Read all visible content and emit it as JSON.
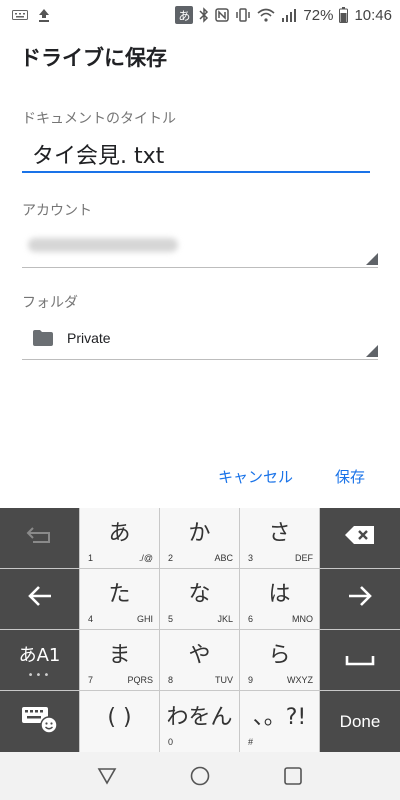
{
  "status_bar": {
    "ime_indicator": "あ",
    "battery_percent": "72%",
    "time": "10:46",
    "left_icons": [
      "keyboard-icon",
      "upload-icon"
    ],
    "right_icons": [
      "bluetooth-icon",
      "nfc-icon",
      "vibrate-icon",
      "wifi-icon",
      "signal-icon",
      "battery-icon"
    ]
  },
  "dialog": {
    "title": "ドライブに保存",
    "doc_title_label": "ドキュメントのタイトル",
    "doc_title_value": "タイ会見. txt",
    "account_label": "アカウント",
    "folder_label": "フォルダ",
    "folder_name": "Private",
    "cancel_label": "キャンセル",
    "save_label": "保存",
    "accent_color": "#1a73e8"
  },
  "keyboard": {
    "row1": [
      {
        "icon": "undo-icon"
      },
      {
        "main": "あ",
        "num": "1",
        "sub": "./@"
      },
      {
        "main": "か",
        "num": "2",
        "sub": "ABC"
      },
      {
        "main": "さ",
        "num": "3",
        "sub": "DEF"
      },
      {
        "icon": "backspace-icon"
      }
    ],
    "row2": [
      {
        "icon": "arrow-left-icon"
      },
      {
        "main": "た",
        "num": "4",
        "sub": "GHI"
      },
      {
        "main": "な",
        "num": "5",
        "sub": "JKL"
      },
      {
        "main": "は",
        "num": "6",
        "sub": "MNO"
      },
      {
        "icon": "arrow-right-icon"
      }
    ],
    "row3": [
      {
        "main": "あA1",
        "dots": "•••"
      },
      {
        "main": "ま",
        "num": "7",
        "sub": "PQRS"
      },
      {
        "main": "や",
        "num": "8",
        "sub": "TUV"
      },
      {
        "main": "ら",
        "num": "9",
        "sub": "WXYZ"
      },
      {
        "icon": "space-icon"
      }
    ],
    "row4": [
      {
        "icon": "keyboard-emoji-icon"
      },
      {
        "main": "( )"
      },
      {
        "main": "わをん",
        "num": "0"
      },
      {
        "main": "、。?!",
        "num": "#"
      },
      {
        "label": "Done"
      }
    ]
  },
  "nav_bar": {
    "icons": [
      "back-icon",
      "home-icon",
      "recents-icon"
    ]
  }
}
